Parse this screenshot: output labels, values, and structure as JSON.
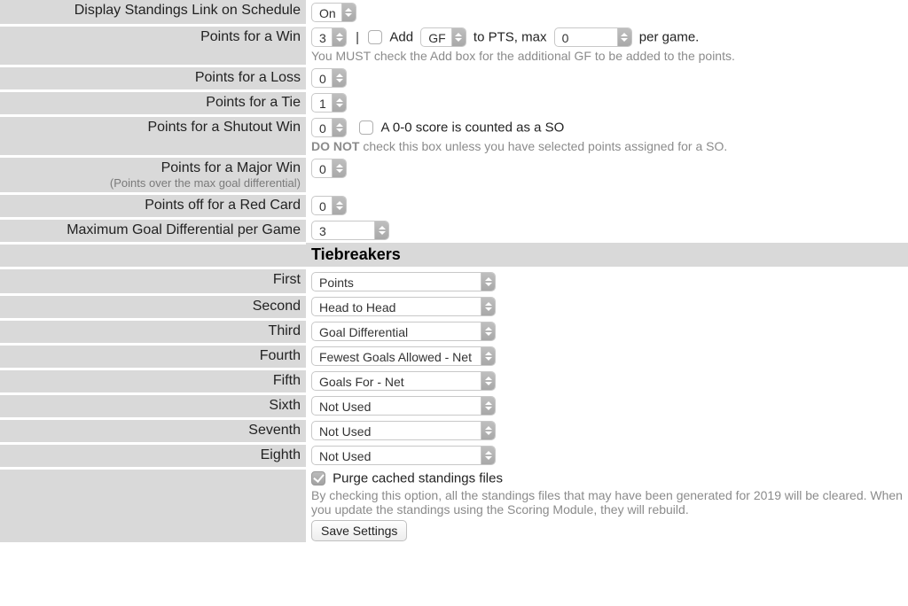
{
  "rows": {
    "display_link": {
      "label": "Display Standings Link on Schedule",
      "value": "On"
    },
    "points_win": {
      "label": "Points for a Win",
      "value": "3",
      "add_label": "Add",
      "gf_value": "GF",
      "to_pts_label": "to PTS, max",
      "max_value": "0",
      "per_game_label": "per game.",
      "hint": "You MUST check the Add box for the additional GF to be added to the points."
    },
    "points_loss": {
      "label": "Points for a Loss",
      "value": "0"
    },
    "points_tie": {
      "label": "Points for a Tie",
      "value": "1"
    },
    "points_shutout": {
      "label": "Points for a Shutout Win",
      "value": "0",
      "so_label": "A 0-0 score is counted as a SO",
      "hint_strong": "DO NOT",
      "hint_rest": " check this box unless you have selected points assigned for a SO."
    },
    "points_major": {
      "label": "Points for a Major Win",
      "sub": "(Points over the max goal differential)",
      "value": "0"
    },
    "points_redcard": {
      "label": "Points off for a Red Card",
      "value": "0"
    },
    "max_diff": {
      "label": "Maximum Goal Differential per Game",
      "value": "3"
    }
  },
  "tiebreakers": {
    "header": "Tiebreakers",
    "items": [
      {
        "label": "First",
        "value": "Points"
      },
      {
        "label": "Second",
        "value": "Head to Head"
      },
      {
        "label": "Third",
        "value": "Goal Differential"
      },
      {
        "label": "Fourth",
        "value": "Fewest Goals Allowed - Net"
      },
      {
        "label": "Fifth",
        "value": "Goals For - Net"
      },
      {
        "label": "Sixth",
        "value": "Not Used"
      },
      {
        "label": "Seventh",
        "value": "Not Used"
      },
      {
        "label": "Eighth",
        "value": "Not Used"
      }
    ]
  },
  "purge": {
    "label": "Purge cached standings files",
    "hint": "By checking this option, all the standings files that may have been generated for 2019 will be cleared. When you update the standings using the Scoring Module, they will rebuild."
  },
  "save_button": "Save Settings"
}
